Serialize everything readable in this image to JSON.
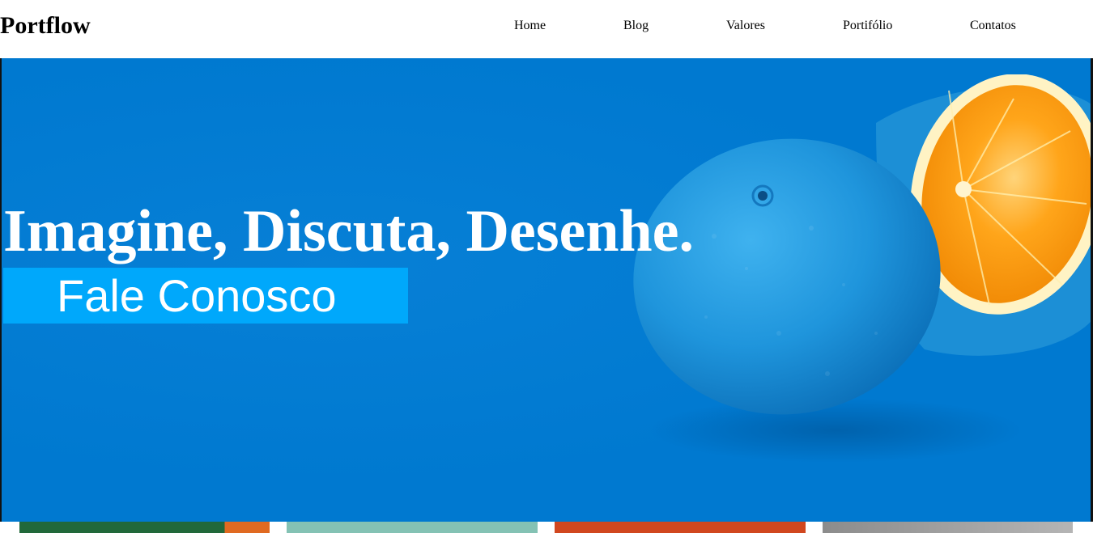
{
  "header": {
    "logo": "Portflow",
    "nav": [
      {
        "label": "Home"
      },
      {
        "label": "Blog"
      },
      {
        "label": "Valores"
      },
      {
        "label": "Portifólio"
      },
      {
        "label": "Contatos"
      }
    ]
  },
  "hero": {
    "title": "Imagine, Discuta, Desenhe.",
    "cta_label": "Fale Conosco",
    "image": "blue-painted-orange-halves",
    "colors": {
      "background": "#0079d0",
      "cta_background": "#00a8fb",
      "text": "#ffffff"
    }
  },
  "cards": [
    {
      "image": "green-abstract-thumbnail"
    },
    {
      "image": "teal-thumbnail"
    },
    {
      "image": "red-orange-thumbnail"
    },
    {
      "image": "gray-thumbnail"
    }
  ]
}
